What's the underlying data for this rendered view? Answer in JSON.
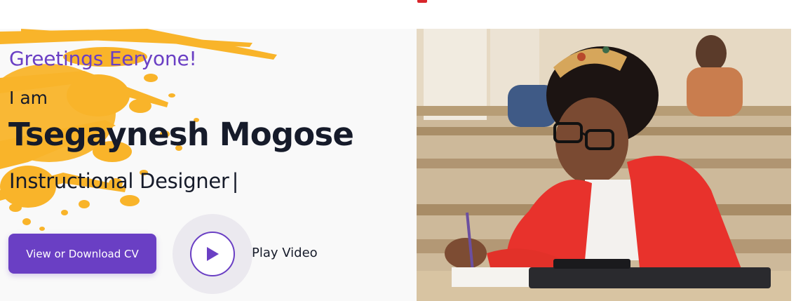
{
  "hero": {
    "greeting": "Greetings Eeryone!",
    "intro": "I am",
    "name": "Tsegaynesh Mogose",
    "role": "Instructional Designer",
    "cursor": "|",
    "cv_button_label": "View or Download CV",
    "play_label": "Play Video",
    "portrait_alt": "Tsegaynesh Mogose writing at a desk in a classroom"
  },
  "colors": {
    "accent": "#6a3fc4",
    "text": "#161b2a",
    "splash": "#f9b42a",
    "top_marker": "#d8262b"
  },
  "icons": {
    "play": "play-icon"
  }
}
